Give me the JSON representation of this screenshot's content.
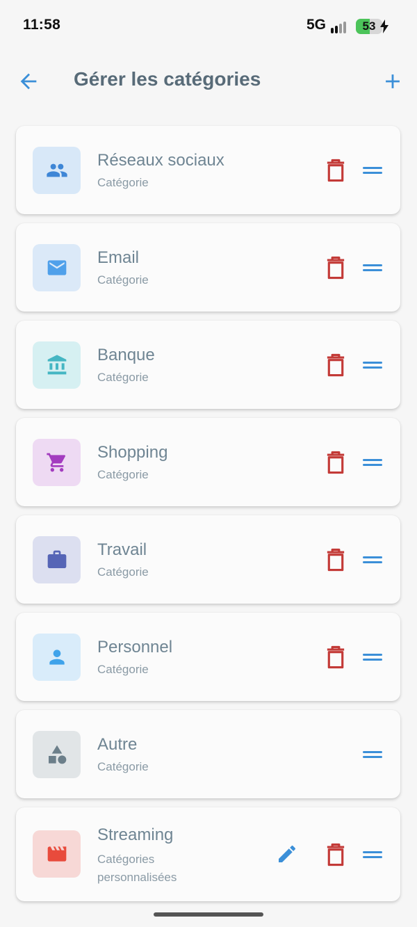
{
  "status": {
    "time": "11:58",
    "network": "5G",
    "battery": "53",
    "battery_level": 0.53,
    "battery_color": "#4cc45a"
  },
  "header": {
    "title": "Gérer les catégories",
    "back_icon": "arrow-left-icon",
    "add_icon": "plus-icon",
    "accent_color": "#3b8fd8"
  },
  "categories": [
    {
      "name": "Réseaux sociaux",
      "subtitle": "Catégorie",
      "icon": "people-icon",
      "icon_color": "#3e86d6",
      "bg_color": "#d8e8f8",
      "deletable": true,
      "editable": false
    },
    {
      "name": "Email",
      "subtitle": "Catégorie",
      "icon": "email-icon",
      "icon_color": "#4fa0ea",
      "bg_color": "#dbe9f8",
      "deletable": true,
      "editable": false
    },
    {
      "name": "Banque",
      "subtitle": "Catégorie",
      "icon": "bank-icon",
      "icon_color": "#45b6c3",
      "bg_color": "#d6f0f2",
      "deletable": true,
      "editable": false
    },
    {
      "name": "Shopping",
      "subtitle": "Catégorie",
      "icon": "cart-icon",
      "icon_color": "#a33cbf",
      "bg_color": "#eedaf3",
      "deletable": true,
      "editable": false
    },
    {
      "name": "Travail",
      "subtitle": "Catégorie",
      "icon": "briefcase-icon",
      "icon_color": "#5665b6",
      "bg_color": "#dcdff0",
      "deletable": true,
      "editable": false
    },
    {
      "name": "Personnel",
      "subtitle": "Catégorie",
      "icon": "person-icon",
      "icon_color": "#3fa3ea",
      "bg_color": "#d9ecfa",
      "deletable": true,
      "editable": false
    },
    {
      "name": "Autre",
      "subtitle": "Catégorie",
      "icon": "shapes-icon",
      "icon_color": "#6c7f8a",
      "bg_color": "#e1e5e7",
      "deletable": false,
      "editable": false
    },
    {
      "name": "Streaming",
      "subtitle": "Catégories personnalisées",
      "icon": "clapperboard-icon",
      "icon_color": "#e84b3c",
      "bg_color": "#f7d8d6",
      "deletable": true,
      "editable": true
    }
  ],
  "action_colors": {
    "delete": "#c33a37",
    "drag": "#3b8fd8",
    "edit": "#3b8fd8"
  }
}
